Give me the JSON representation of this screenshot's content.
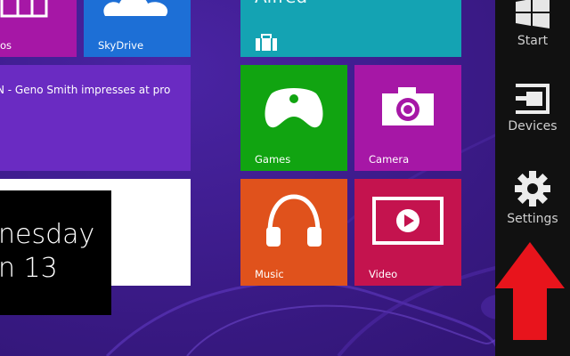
{
  "tiles": {
    "photos": {
      "label": "os",
      "color": "#a617a6"
    },
    "skydrive": {
      "label": "SkyDrive",
      "color": "#1d6fd6"
    },
    "travel": {
      "label": "Alfred",
      "color": "#14a3b3"
    },
    "news": {
      "headline": "N - Geno Smith impresses at pro",
      "color": "#6a2bc2"
    },
    "games": {
      "label": "Games",
      "color": "#11a411"
    },
    "camera": {
      "label": "Camera",
      "color": "#a617a6"
    },
    "music": {
      "label": "Music",
      "color": "#e0521c"
    },
    "video": {
      "label": "Video",
      "color": "#c4134e"
    },
    "blank": {
      "color": "#ffffff"
    }
  },
  "calendar": {
    "day": "nesday",
    "date": "n 13"
  },
  "charms": {
    "start": {
      "label": "Start",
      "icon": "windows-logo-icon"
    },
    "devices": {
      "label": "Devices",
      "icon": "devices-icon"
    },
    "settings": {
      "label": "Settings",
      "icon": "gear-icon"
    }
  },
  "annotation": {
    "color": "#e8141c",
    "icon": "red-up-arrow"
  }
}
